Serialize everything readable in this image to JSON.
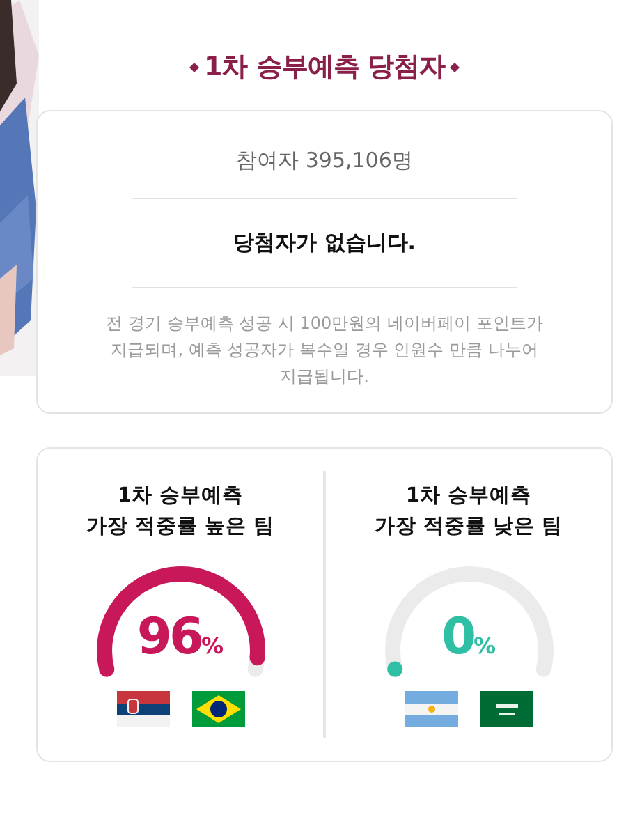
{
  "title": "1차 승부예측 당첨자",
  "summary": {
    "participants": "참여자 395,106명",
    "result": "당첨자가 없습니다.",
    "note": "전 경기 승부예측 성공 시 100만원의 네이버페이 포인트가 지급되며, 예측 성공자가 복수일 경우 인원수 만큼 나누어 지급됩니다."
  },
  "gauges": [
    {
      "heading": "1차 승부예측\n가장 적중률 높은 팀",
      "reading": "96",
      "unit": "%",
      "color": "#c8185a"
    },
    {
      "heading": "1차 승부예측\n가장 적중률 낮은 팀",
      "reading": "0",
      "unit": "%",
      "color": "#2ebfa5"
    }
  ]
}
